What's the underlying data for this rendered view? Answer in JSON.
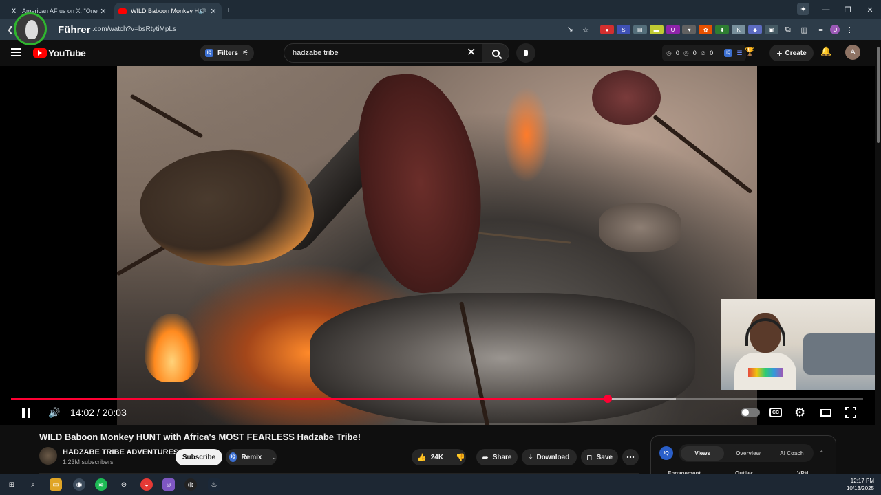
{
  "browser": {
    "tabs": [
      {
        "title": "American AF us on X: \"One of t",
        "favicon": "x-logo-icon",
        "active": false
      },
      {
        "title": "WILD Baboon Monkey HUN",
        "favicon": "youtube-icon",
        "active": true,
        "audio": true
      }
    ],
    "url": ".com/watch?v=bsRtytiMpLs",
    "overlay_name": "Führer"
  },
  "youtube": {
    "logo_text": "YouTube",
    "filters_label": "Filters",
    "search_value": "hadzabe tribe",
    "stats": [
      "0",
      "0",
      "0"
    ],
    "create_label": "Create",
    "user_initial": "A"
  },
  "player": {
    "current_time": "14:02",
    "duration": "20:03",
    "timecode_text": "14:02 / 20:03",
    "progress_fraction": 0.7,
    "buffered_fraction": 0.78,
    "cc_label": "CC"
  },
  "video": {
    "title": "WILD Baboon Monkey HUNT with Africa's MOST FEARLESS Hadzabe Tribe!",
    "channel": "HADZABE TRIBE ADVENTURES",
    "subscribers": "1.23M subscribers",
    "subscribe_label": "Subscribe",
    "remix_label": "Remix",
    "likes": "24K",
    "share_label": "Share",
    "download_label": "Download",
    "save_label": "Save"
  },
  "iq_panel": {
    "logo": "IQ",
    "tabs": [
      "Views",
      "Overview",
      "AI Coach"
    ],
    "active_tab": "Views",
    "columns": [
      "Engagement",
      "Outlier",
      "VPH"
    ]
  },
  "taskbar": {
    "time": "12:17 PM",
    "date": "10/13/2025"
  },
  "colors": {
    "accent_red": "#ff0033",
    "yt_red": "#ff0000",
    "background": "#0f0f0f"
  }
}
